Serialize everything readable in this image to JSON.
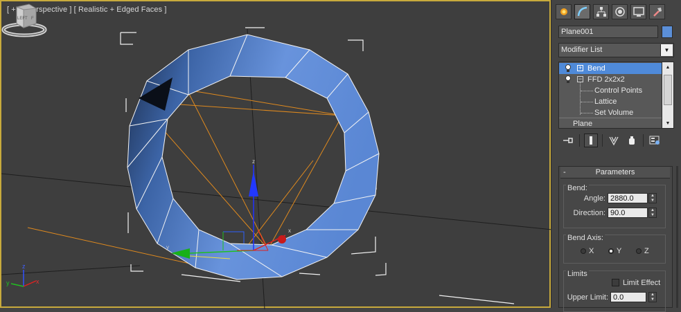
{
  "viewport": {
    "label_parts": [
      "[ + ]",
      "[ Perspective ]",
      "[ Realistic + Edged Faces ]"
    ],
    "viewcube_face": "LEFT",
    "viewcube_side": "F",
    "gizmo_axes": [
      "x",
      "y",
      "z"
    ],
    "corner_axes": [
      "x",
      "y",
      "z"
    ]
  },
  "panel": {
    "tabs": [
      {
        "name": "create-tab",
        "icon": "create-icon"
      },
      {
        "name": "modify-tab",
        "icon": "modify-icon"
      },
      {
        "name": "hierarchy-tab",
        "icon": "hierarchy-icon"
      },
      {
        "name": "motion-tab",
        "icon": "motion-icon"
      },
      {
        "name": "display-tab",
        "icon": "display-icon"
      },
      {
        "name": "utilities-tab",
        "icon": "utilities-icon"
      }
    ],
    "object_name": "Plane001",
    "object_color": "#5b8fd8",
    "modifier_list_label": "Modifier List",
    "stack": [
      {
        "label": "Bend",
        "selected": true,
        "box": "+"
      },
      {
        "label": "FFD 2x2x2",
        "selected": false,
        "box": "−"
      },
      {
        "label": "Control Points"
      },
      {
        "label": "Lattice"
      },
      {
        "label": "Set Volume"
      },
      {
        "label": "Plane"
      }
    ],
    "toolbar_icons": [
      "pin-stack-icon",
      "show-end-result-icon",
      "make-unique-icon",
      "remove-modifier-icon",
      "configure-modifier-sets-icon"
    ],
    "parameters": {
      "title": "Parameters",
      "collapse_symbol": "-",
      "bend_group": "Bend:",
      "angle_label": "Angle:",
      "angle_value": "2880.0",
      "direction_label": "Direction:",
      "direction_value": "90.0",
      "bend_axis_group": "Bend Axis:",
      "axes": [
        {
          "label": "X",
          "selected": false
        },
        {
          "label": "Y",
          "selected": true
        },
        {
          "label": "Z",
          "selected": false
        }
      ],
      "limits_group": "Limits",
      "limit_effect_label": "Limit Effect",
      "limit_effect_checked": false,
      "upper_limit_label": "Upper Limit:",
      "upper_limit_value": "0.0"
    }
  },
  "colors": {
    "viewport_border": "#c8aa3c",
    "selection_blue": "#4f8ad9",
    "mesh_blue": "#5a87d4"
  }
}
